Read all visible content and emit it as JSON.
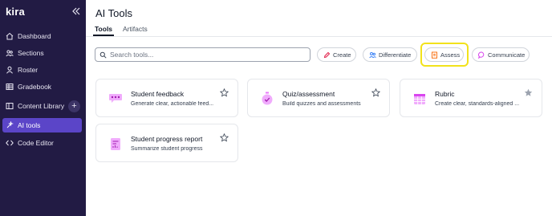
{
  "sidebar": {
    "logo": "kira",
    "items": [
      {
        "label": "Dashboard",
        "icon": "home-icon"
      },
      {
        "label": "Sections",
        "icon": "users-icon"
      },
      {
        "label": "Roster",
        "icon": "user-icon"
      },
      {
        "label": "Gradebook",
        "icon": "table-icon"
      },
      {
        "label": "Content Library",
        "icon": "book-icon"
      },
      {
        "label": "AI tools",
        "icon": "sparkle-icon",
        "active": true
      },
      {
        "label": "Code Editor",
        "icon": "code-icon"
      }
    ],
    "add_label": "+"
  },
  "main": {
    "title": "AI Tools",
    "tabs": [
      {
        "label": "Tools",
        "active": true
      },
      {
        "label": "Artifacts",
        "active": false
      }
    ],
    "search": {
      "placeholder": "Search tools...",
      "value": ""
    },
    "filters": [
      {
        "label": "Create",
        "icon": "pencil-icon",
        "color": "#e11d48"
      },
      {
        "label": "Differentiate",
        "icon": "people-icon",
        "color": "#3b82f6"
      },
      {
        "label": "Assess",
        "icon": "clipboard-icon",
        "color": "#f97316",
        "highlighted": true
      },
      {
        "label": "Communicate",
        "icon": "chat-icon",
        "color": "#d946ef"
      }
    ],
    "tools": [
      {
        "title": "Student feedback",
        "description": "Generate clear, actionable feed...",
        "icon": "speech-bubble-icon"
      },
      {
        "title": "Quiz/assessment",
        "description": "Build quizzes and assessments",
        "icon": "stopwatch-icon"
      },
      {
        "title": "Rubric",
        "description": "Create clear, standards-aligned ...",
        "icon": "grid-icon",
        "starred": true
      },
      {
        "title": "Student progress report",
        "description": "Summarize student progress",
        "icon": "report-icon"
      }
    ]
  },
  "colors": {
    "sidebar_bg": "#221b44",
    "active_item": "#5b45c8",
    "accent_pink": "#e879f9",
    "highlight": "#f2e21b"
  }
}
